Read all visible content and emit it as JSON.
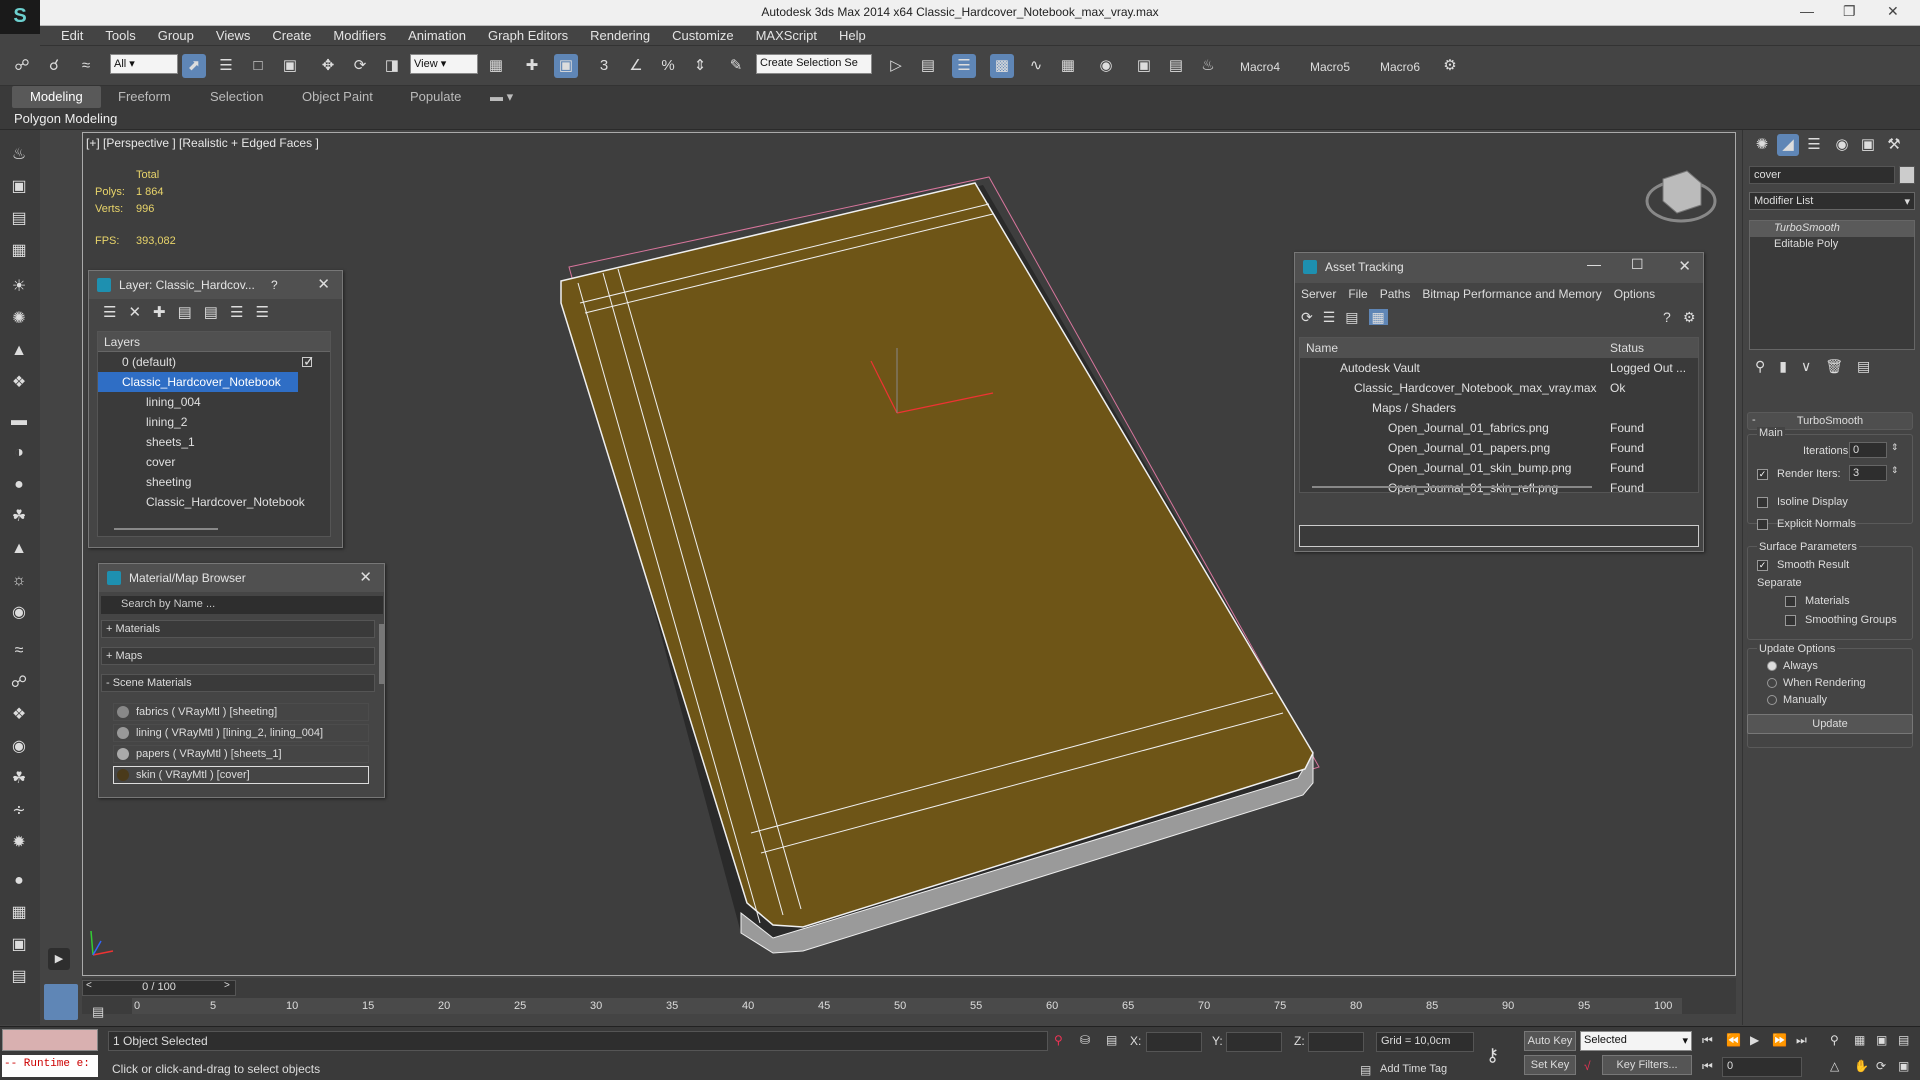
{
  "app": {
    "title": "Autodesk 3ds Max  2014 x64    Classic_Hardcover_Notebook_max_vray.max"
  },
  "menu": [
    "Edit",
    "Tools",
    "Group",
    "Views",
    "Create",
    "Modifiers",
    "Animation",
    "Graph Editors",
    "Rendering",
    "Customize",
    "MAXScript",
    "Help"
  ],
  "toolbar": {
    "filter": "All",
    "refcoord": "View",
    "selset": "Create Selection Se",
    "macros": [
      "Macro4",
      "Macro5",
      "Macro6"
    ]
  },
  "ribbon": {
    "tabs": [
      "Modeling",
      "Freeform",
      "Selection",
      "Object Paint",
      "Populate"
    ],
    "active": "Modeling",
    "sub": "Polygon Modeling"
  },
  "viewport": {
    "label": "[+] [Perspective ] [Realistic + Edged Faces ]",
    "stats": {
      "total": "Total",
      "polys_label": "Polys:",
      "polys": "1 864",
      "verts_label": "Verts:",
      "verts": "996",
      "fps_label": "FPS:",
      "fps": "393,082"
    }
  },
  "layer": {
    "title": "Layer: Classic_Hardcov...",
    "help": "?",
    "col": "Layers",
    "rows": [
      "0 (default)",
      "Classic_Hardcover_Notebook",
      "lining_004",
      "lining_2",
      "sheets_1",
      "cover",
      "sheeting",
      "Classic_Hardcover_Notebook"
    ]
  },
  "material": {
    "title": "Material/Map Browser",
    "search": "Search by Name ...",
    "groups": [
      "+ Materials",
      "+ Maps",
      "- Scene Materials"
    ],
    "items": [
      "fabrics  ( VRayMtl )  [sheeting]",
      "lining  ( VRayMtl )  [lining_2, lining_004]",
      "papers  ( VRayMtl )  [sheets_1]",
      "skin  ( VRayMtl )  [cover]"
    ]
  },
  "asset": {
    "title": "Asset Tracking",
    "menu": [
      "Server",
      "File",
      "Paths",
      "Bitmap Performance and Memory",
      "Options"
    ],
    "cols": [
      "Name",
      "Status"
    ],
    "rows": [
      {
        "name": "Autodesk Vault",
        "status": "Logged Out ..."
      },
      {
        "name": "Classic_Hardcover_Notebook_max_vray.max",
        "status": "Ok"
      },
      {
        "name": "Maps / Shaders",
        "status": ""
      },
      {
        "name": "Open_Journal_01_fabrics.png",
        "status": "Found"
      },
      {
        "name": "Open_Journal_01_papers.png",
        "status": "Found"
      },
      {
        "name": "Open_Journal_01_skin_bump.png",
        "status": "Found"
      },
      {
        "name": "Open_Journal_01_skin_refl.png",
        "status": "Found"
      }
    ]
  },
  "cmd": {
    "object_name": "cover",
    "modlist": "Modifier List",
    "stack": [
      "TurboSmooth",
      "Editable Poly"
    ],
    "ts": {
      "title": "TurboSmooth",
      "main": "Main",
      "iter_label": "Iterations:",
      "iter": "0",
      "render_label": "Render Iters:",
      "render": "3",
      "isoline": "Isoline Display",
      "explicit": "Explicit Normals",
      "surface": "Surface Parameters",
      "smooth": "Smooth Result",
      "separate": "Separate",
      "materials": "Materials",
      "sgroups": "Smoothing Groups",
      "update_opts": "Update Options",
      "always": "Always",
      "when_render": "When Rendering",
      "manually": "Manually",
      "update_btn": "Update"
    }
  },
  "timeline": {
    "frame": "0 / 100",
    "ticks": [
      "0",
      "5",
      "10",
      "15",
      "20",
      "25",
      "30",
      "35",
      "40",
      "45",
      "50",
      "55",
      "60",
      "65",
      "70",
      "75",
      "80",
      "85",
      "90",
      "95",
      "100"
    ]
  },
  "status": {
    "runtime": "-- Runtime e:",
    "selected": "1 Object Selected",
    "prompt": "Click or click-and-drag to select objects",
    "x": "X:",
    "y": "Y:",
    "z": "Z:",
    "grid": "Grid = 10,0cm",
    "autokey": "Auto Key",
    "setkey": "Set Key",
    "sel_mode": "Selected",
    "keyfilters": "Key Filters...",
    "addtime": "Add Time Tag",
    "frame_field": "0"
  },
  "colors": {
    "cover": "#6e5517",
    "selection": "#2f6ec5",
    "accent": "#5f86b6"
  }
}
